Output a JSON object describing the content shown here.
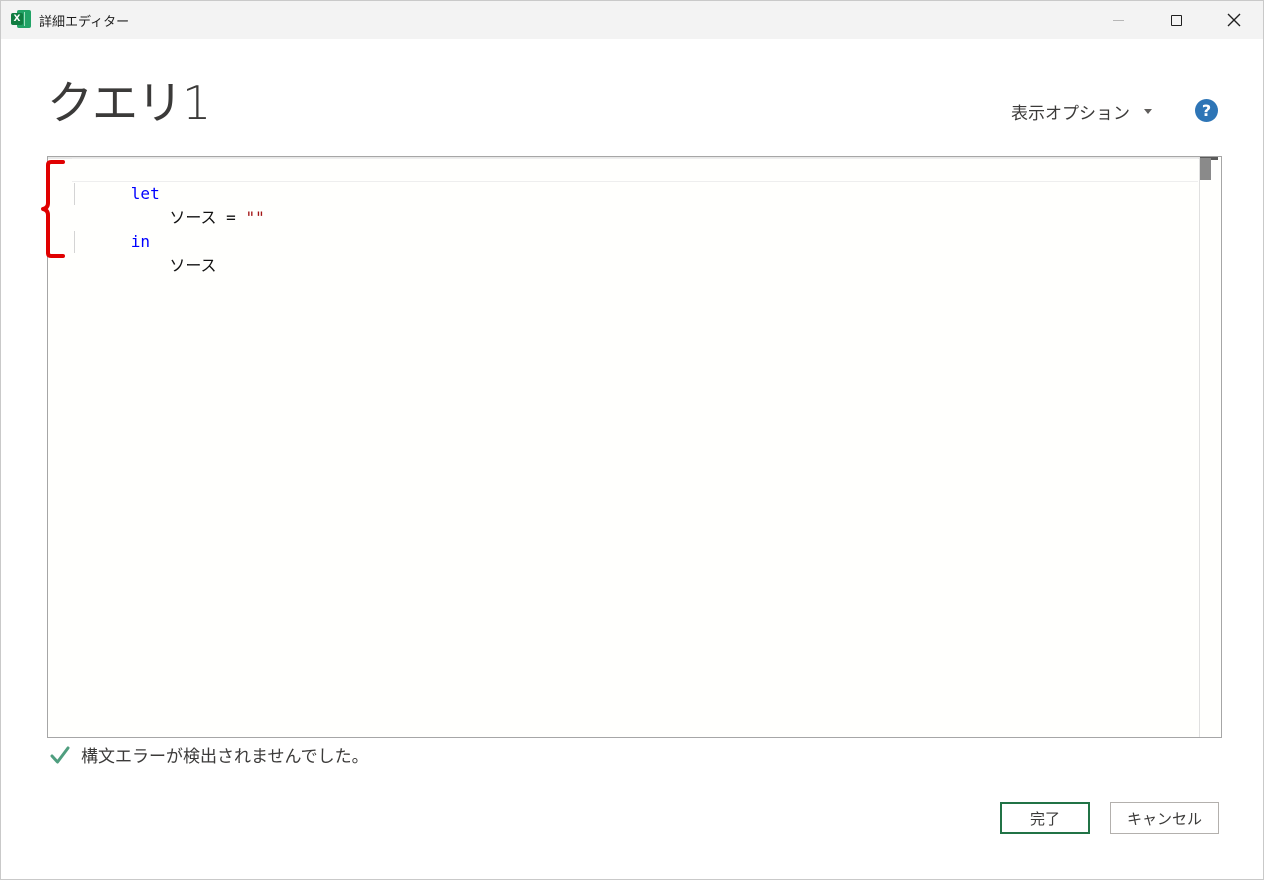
{
  "window": {
    "title": "詳細エディター",
    "app_icon": "excel-icon",
    "app_icon_letter": "X",
    "controls": {
      "minimize": "minimize-icon",
      "maximize": "maximize-icon",
      "close_glyph": "✕"
    }
  },
  "header": {
    "query_name": "クエリ1",
    "display_options_label": "表示オプション",
    "help_glyph": "?"
  },
  "editor": {
    "lines": [
      {
        "keyword": "let",
        "text": "",
        "string": ""
      },
      {
        "keyword": "",
        "text": "    ソース = ",
        "string": "\"\""
      },
      {
        "keyword": "in",
        "text": "",
        "string": ""
      },
      {
        "keyword": "",
        "text": "    ソース",
        "string": ""
      }
    ]
  },
  "status": {
    "message": "構文エラーが検出されませんでした。",
    "icon": "check-icon"
  },
  "buttons": {
    "done_label": "完了",
    "cancel_label": "キャンセル"
  },
  "colors": {
    "keyword": "#0000ff",
    "string": "#a31515",
    "accent_green": "#217346",
    "check_green": "#4f9e7f",
    "help_blue": "#2e75b6",
    "annotation_red": "#e00000"
  }
}
